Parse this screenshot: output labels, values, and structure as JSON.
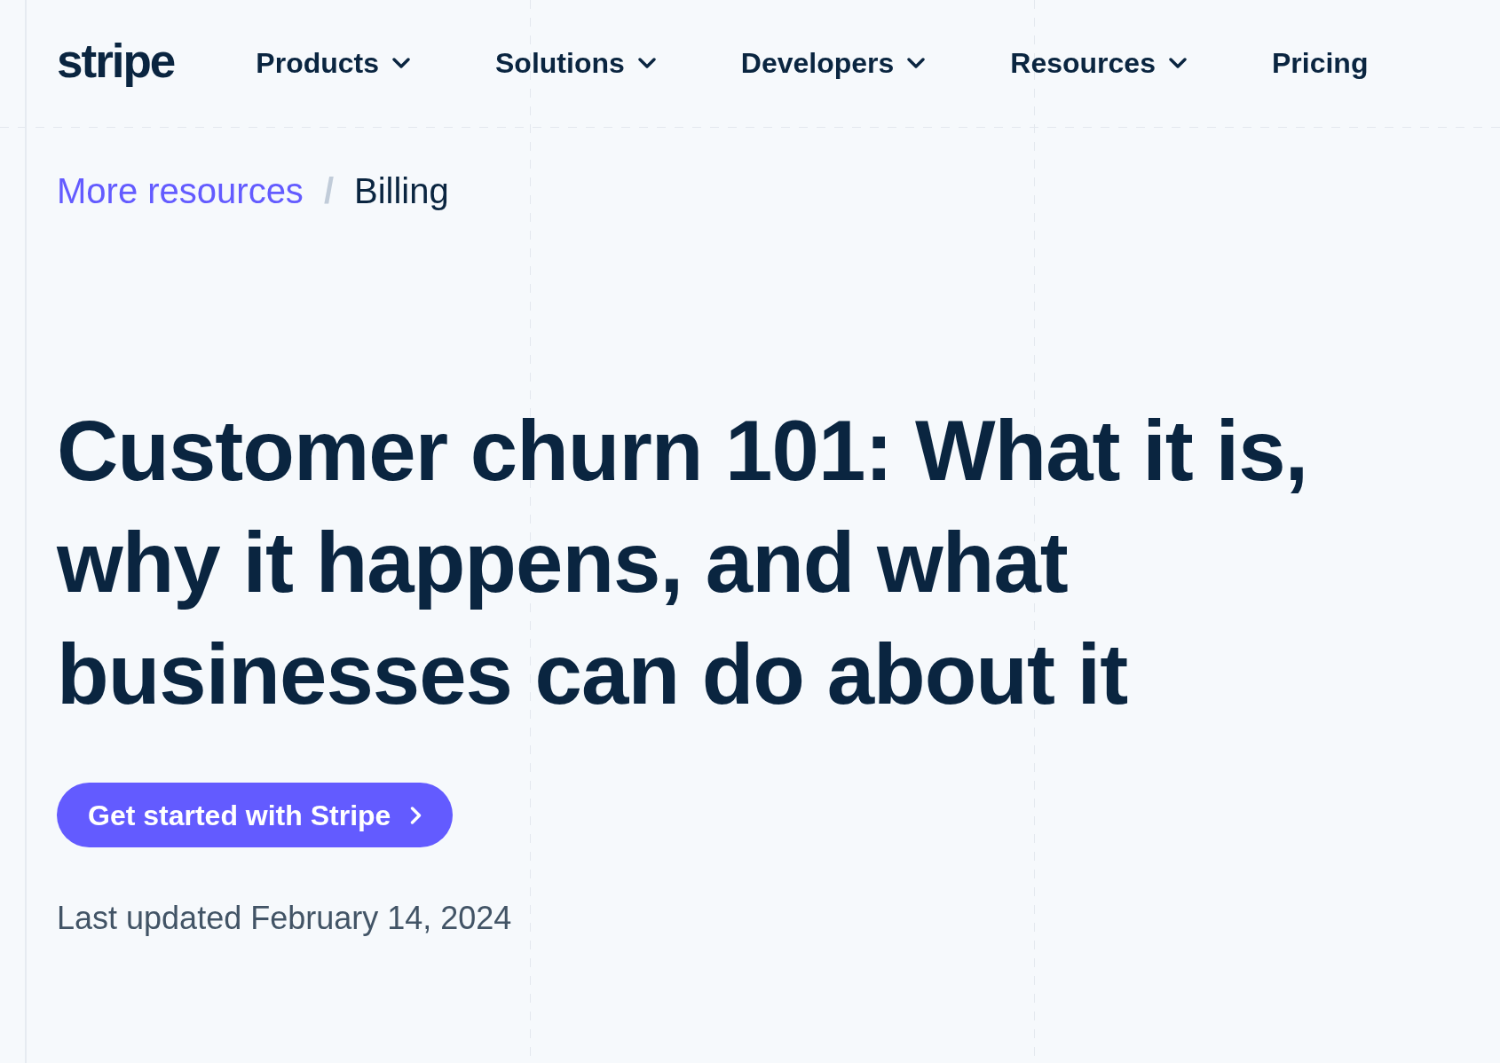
{
  "header": {
    "logo": "stripe",
    "nav": [
      {
        "label": "Products",
        "kind": "menu"
      },
      {
        "label": "Solutions",
        "kind": "menu"
      },
      {
        "label": "Developers",
        "kind": "menu"
      },
      {
        "label": "Resources",
        "kind": "menu"
      },
      {
        "label": "Pricing",
        "kind": "link"
      }
    ]
  },
  "breadcrumb": {
    "separator": "/",
    "items": [
      {
        "label": "More resources",
        "kind": "link"
      },
      {
        "label": "Billing",
        "kind": "current"
      }
    ]
  },
  "article": {
    "title": "Customer churn 101: What it is, why it happens, and what businesses can do about it",
    "cta": {
      "label": "Get started with Stripe"
    },
    "updated": "Last updated February 14, 2024"
  }
}
